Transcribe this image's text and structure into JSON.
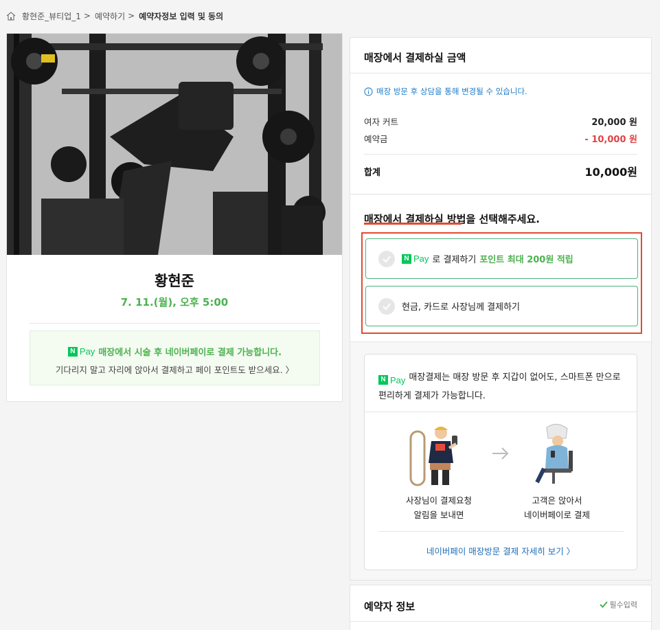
{
  "breadcrumb": {
    "home_icon": "home-icon",
    "items": [
      "황현준_뷰티업_1",
      "예약하기",
      "예약자정보 입력 및 동의"
    ],
    "separator": ">"
  },
  "shop": {
    "name": "황현준",
    "datetime": "7. 11.(월), 오후 5:00",
    "photo_alt": "gym equipment photo",
    "promo": {
      "npay_n": "N",
      "npay_pay": "Pay",
      "line1": "매장에서 시술 후 네이버페이로 결제 가능합니다.",
      "line2": "기다리지 말고 자리에 앉아서 결제하고 페이 포인트도 받으세요. 〉"
    }
  },
  "payment": {
    "header": "매장에서 결제하실 금액",
    "notice": "매장 방문 후 상담을 통해 변경될 수 있습니다.",
    "items": [
      {
        "label": "여자 커트",
        "amount": "20,000 원"
      },
      {
        "label": "예약금",
        "amount": "- 10,000 원"
      }
    ],
    "total_label": "합계",
    "total_amount": "10,000원"
  },
  "method": {
    "title": "매장에서 결제하실 방법을 선택해주세요.",
    "option1": {
      "npay_n": "N",
      "npay_pay": "Pay",
      "label": "로 결제하기",
      "point": "포인트 최대 200원 적립"
    },
    "option2": {
      "label": "현금, 카드로 사장님께 결제하기"
    },
    "highlight_color": "#e24a2e"
  },
  "info": {
    "npay_n": "N",
    "npay_pay": "Pay",
    "text": "매장결제는 매장 방문 후 지갑이 없어도, 스마트폰 만으로 편리하게 결제가 가능합니다.",
    "step1_line1": "사장님이 결제요청",
    "step1_line2": "알림을 보내면",
    "step2_line1": "고객은 앉아서",
    "step2_line2": "네이버페이로 결제",
    "link": "네이버페이 매장방문 결제 자세히 보기 〉"
  },
  "booker": {
    "title": "예약자 정보",
    "required": "필수입력"
  },
  "colors": {
    "accent_green": "#4cb24f",
    "npay_green": "#03c75a",
    "link_blue": "#1f6fb8",
    "discount_red": "#e04444"
  }
}
